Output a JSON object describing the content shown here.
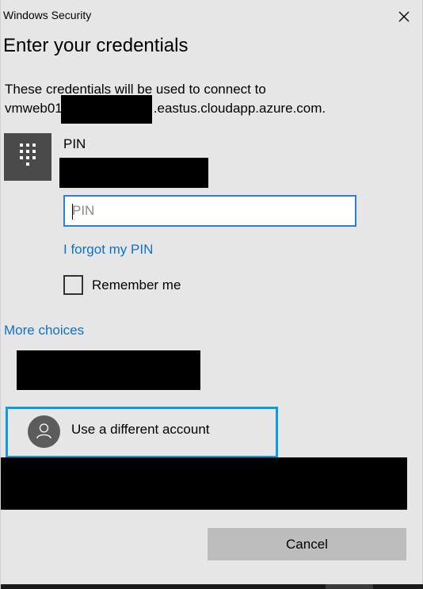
{
  "window": {
    "title": "Windows Security",
    "close_icon": "close-icon"
  },
  "heading": "Enter your credentials",
  "description": {
    "line1": "These credentials will be used to connect to",
    "host_prefix": "vmweb01",
    "host_suffix": ".eastus.cloudapp.azure.com."
  },
  "pin_section": {
    "icon": "keypad-icon",
    "label": "PIN",
    "input_placeholder": "PIN",
    "input_value": "",
    "forgot_link": "I forgot my PIN",
    "remember_label": "Remember me",
    "remember_checked": false
  },
  "more_choices": {
    "link": "More choices",
    "accounts": [
      {
        "label": "Use a different account",
        "icon": "person-icon",
        "selected": true
      }
    ]
  },
  "buttons": {
    "cancel": "Cancel"
  },
  "colors": {
    "background": "#e6e6e6",
    "link": "#0f73c4",
    "focus_border": "#2b7fd9",
    "selected_border": "#0a9be3",
    "redaction": "#000000"
  }
}
